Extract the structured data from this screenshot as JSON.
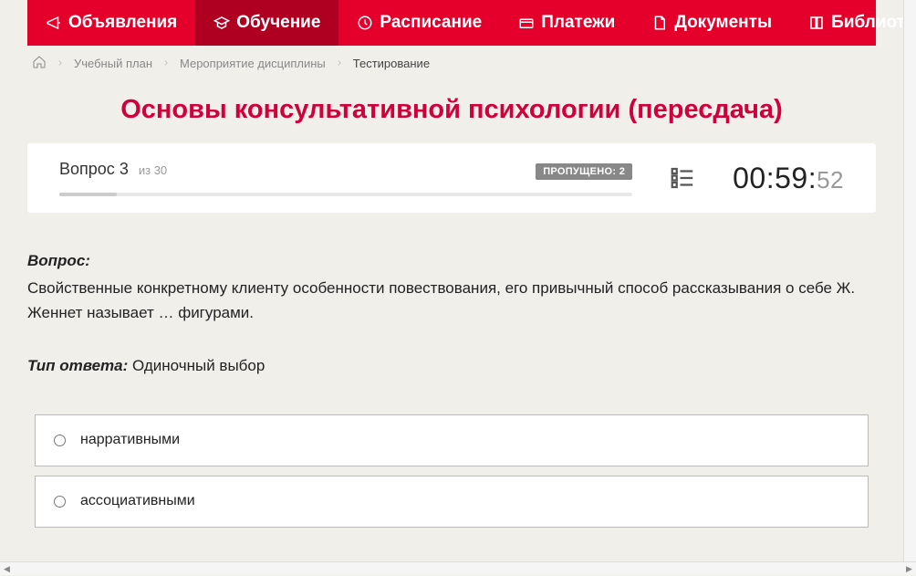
{
  "nav": {
    "items": [
      {
        "label": "Объявления",
        "icon": "megaphone-icon"
      },
      {
        "label": "Обучение",
        "icon": "education-icon",
        "active": true
      },
      {
        "label": "Расписание",
        "icon": "clock-icon"
      },
      {
        "label": "Платежи",
        "icon": "payment-icon"
      },
      {
        "label": "Документы",
        "icon": "document-icon"
      },
      {
        "label": "Библиотека",
        "icon": "book-icon",
        "dropdown": true
      }
    ]
  },
  "breadcrumb": {
    "items": [
      "Учебный план",
      "Мероприятие дисциплины",
      "Тестирование"
    ]
  },
  "page_title": "Основы консультативной психологии (пересдача)",
  "status": {
    "question_label": "Вопрос",
    "question_number": "3",
    "total_prefix": "из",
    "total": "30",
    "missed_label": "ПРОПУЩЕНО: 2",
    "progress_percent": 10,
    "timer_main": "00:59:",
    "timer_sec": "52"
  },
  "question": {
    "label": "Вопрос:",
    "text": "Свойственные конкретному клиенту особенности повествования, его привычный способ рассказывания о себе Ж. Женнет называет … фигурами.",
    "answer_type_label": "Тип ответа:",
    "answer_type_value": "Одиночный выбор",
    "options": [
      "нарративными",
      "ассоциативными"
    ]
  }
}
